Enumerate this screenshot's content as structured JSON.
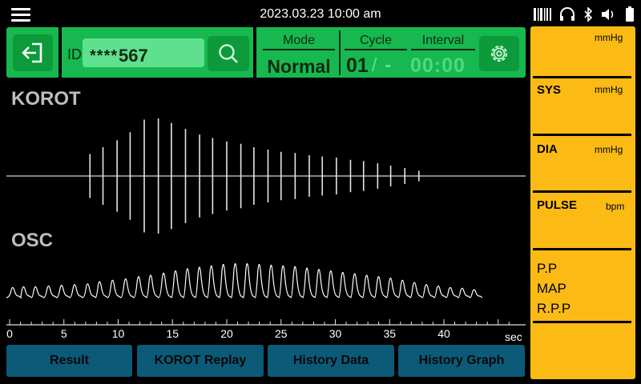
{
  "status_bar": {
    "datetime": "2023.03.23  10:00 am"
  },
  "patient": {
    "id_label": "ID",
    "id_mask": "****",
    "id_value": "567"
  },
  "mode": {
    "label": "Mode",
    "value": "Normal"
  },
  "cycle": {
    "label": "Cycle",
    "value": "01",
    "separator": "/",
    "dash": "-"
  },
  "interval": {
    "label": "Interval",
    "value": "00:00"
  },
  "waveforms": {
    "korot_title": "KOROT",
    "osc_title": "OSC"
  },
  "chart_data": {
    "type": "line",
    "x_axis": {
      "range": [
        0,
        47
      ],
      "ticks": [
        0,
        5,
        10,
        15,
        20,
        25,
        30,
        35,
        40
      ],
      "unit": "sec"
    },
    "korot_pulses": [
      {
        "t": 7.4,
        "amp": 0.38
      },
      {
        "t": 8.6,
        "amp": 0.5
      },
      {
        "t": 9.9,
        "amp": 0.62
      },
      {
        "t": 11.1,
        "amp": 0.76
      },
      {
        "t": 12.4,
        "amp": 0.98
      },
      {
        "t": 13.7,
        "amp": 1.0
      },
      {
        "t": 14.9,
        "amp": 0.92
      },
      {
        "t": 16.2,
        "amp": 0.82
      },
      {
        "t": 17.5,
        "amp": 0.72
      },
      {
        "t": 18.7,
        "amp": 0.66
      },
      {
        "t": 20.0,
        "amp": 0.6
      },
      {
        "t": 21.3,
        "amp": 0.56
      },
      {
        "t": 22.5,
        "amp": 0.5
      },
      {
        "t": 23.8,
        "amp": 0.46
      },
      {
        "t": 25.0,
        "amp": 0.42
      },
      {
        "t": 26.3,
        "amp": 0.4
      },
      {
        "t": 27.6,
        "amp": 0.36
      },
      {
        "t": 28.8,
        "amp": 0.34
      },
      {
        "t": 30.1,
        "amp": 0.32
      },
      {
        "t": 31.4,
        "amp": 0.28
      },
      {
        "t": 32.6,
        "amp": 0.26
      },
      {
        "t": 33.9,
        "amp": 0.22
      },
      {
        "t": 35.1,
        "amp": 0.18
      },
      {
        "t": 36.4,
        "amp": 0.14
      },
      {
        "t": 37.7,
        "amp": 0.09
      }
    ],
    "osc_beats": [
      {
        "t": 0.3,
        "amp": 0.28
      },
      {
        "t": 1.3,
        "amp": 0.3
      },
      {
        "t": 2.4,
        "amp": 0.3
      },
      {
        "t": 3.6,
        "amp": 0.32
      },
      {
        "t": 4.8,
        "amp": 0.34
      },
      {
        "t": 6.0,
        "amp": 0.36
      },
      {
        "t": 7.2,
        "amp": 0.38
      },
      {
        "t": 8.3,
        "amp": 0.44
      },
      {
        "t": 9.5,
        "amp": 0.48
      },
      {
        "t": 10.7,
        "amp": 0.52
      },
      {
        "t": 11.9,
        "amp": 0.58
      },
      {
        "t": 13.0,
        "amp": 0.62
      },
      {
        "t": 14.2,
        "amp": 0.68
      },
      {
        "t": 15.3,
        "amp": 0.74
      },
      {
        "t": 16.4,
        "amp": 0.8
      },
      {
        "t": 17.5,
        "amp": 0.84
      },
      {
        "t": 18.6,
        "amp": 0.88
      },
      {
        "t": 19.7,
        "amp": 0.92
      },
      {
        "t": 20.8,
        "amp": 0.94
      },
      {
        "t": 21.9,
        "amp": 0.94
      },
      {
        "t": 23.0,
        "amp": 0.92
      },
      {
        "t": 24.1,
        "amp": 0.9
      },
      {
        "t": 25.2,
        "amp": 0.88
      },
      {
        "t": 26.3,
        "amp": 0.86
      },
      {
        "t": 27.4,
        "amp": 0.82
      },
      {
        "t": 28.5,
        "amp": 0.78
      },
      {
        "t": 29.6,
        "amp": 0.74
      },
      {
        "t": 30.7,
        "amp": 0.7
      },
      {
        "t": 31.8,
        "amp": 0.66
      },
      {
        "t": 32.9,
        "amp": 0.62
      },
      {
        "t": 34.0,
        "amp": 0.58
      },
      {
        "t": 35.1,
        "amp": 0.54
      },
      {
        "t": 36.2,
        "amp": 0.48
      },
      {
        "t": 37.3,
        "amp": 0.42
      },
      {
        "t": 38.4,
        "amp": 0.36
      },
      {
        "t": 39.5,
        "amp": 0.32
      },
      {
        "t": 40.6,
        "amp": 0.28
      },
      {
        "t": 41.7,
        "amp": 0.26
      },
      {
        "t": 42.8,
        "amp": 0.22
      }
    ]
  },
  "buttons": [
    {
      "name": "result-button",
      "label": "Result"
    },
    {
      "name": "korot-replay-button",
      "label": "KOROT Replay"
    },
    {
      "name": "history-data-button",
      "label": "History Data"
    },
    {
      "name": "history-graph-button",
      "label": "History Graph"
    }
  ],
  "vitals": {
    "top_unit": "mmHg",
    "sys": {
      "label": "SYS",
      "unit": "mmHg"
    },
    "dia": {
      "label": "DIA",
      "unit": "mmHg"
    },
    "pulse": {
      "label": "PULSE",
      "unit": "bpm"
    },
    "pp_label": "P.P",
    "map_label": "MAP",
    "rpp_label": "R.P.P"
  },
  "colors": {
    "accent_green": "#17b84f",
    "panel_yellow": "#fbbb14",
    "button_blue": "#0b5a78"
  },
  "icons": [
    "menu-icon",
    "exit-icon",
    "search-icon",
    "settings-icon",
    "barcode-icon",
    "headset-icon",
    "bluetooth-icon",
    "volume-icon",
    "battery-icon"
  ]
}
